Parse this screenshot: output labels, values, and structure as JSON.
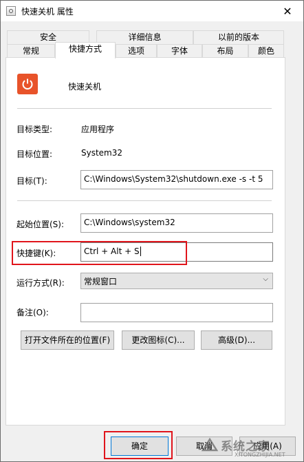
{
  "window": {
    "title": "快速关机 属性",
    "close_glyph": "✕"
  },
  "tabs": {
    "row1": [
      "安全",
      "详细信息",
      "以前的版本"
    ],
    "row2": [
      "常规",
      "快捷方式",
      "选项",
      "字体",
      "布局",
      "颜色"
    ],
    "active": "快捷方式"
  },
  "shortcut": {
    "icon": "power-icon",
    "name": "快速关机",
    "target_type_label": "目标类型:",
    "target_type_value": "应用程序",
    "target_location_label": "目标位置:",
    "target_location_value": "System32",
    "target_label": "目标(T):",
    "target_value": "C:\\Windows\\System32\\shutdown.exe -s -t 5",
    "start_in_label": "起始位置(S):",
    "start_in_value": "C:\\Windows\\system32",
    "hotkey_label": "快捷键(K):",
    "hotkey_value": "Ctrl + Alt + S",
    "run_label": "运行方式(R):",
    "run_value": "常规窗口",
    "comment_label": "备注(O):",
    "comment_value": ""
  },
  "buttons": {
    "open_location": "打开文件所在的位置(F)",
    "change_icon": "更改图标(C)...",
    "advanced": "高级(D)...",
    "ok": "确定",
    "cancel": "取消",
    "apply": "应用(A)"
  },
  "watermark": {
    "text": "系统之家",
    "url": "XITONGZHIJIA.NET"
  },
  "colors": {
    "accent": "#0078d7",
    "highlight_box": "#e0141b",
    "icon_bg": "#e8532a"
  }
}
